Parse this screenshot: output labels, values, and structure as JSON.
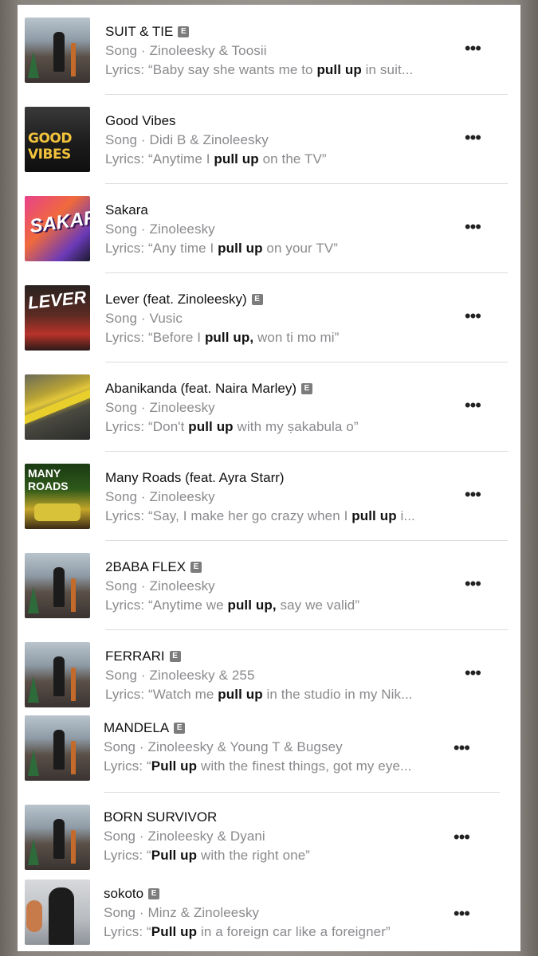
{
  "results": [
    {
      "title": "SUIT & TIE",
      "explicit": true,
      "subtitle": "Song · Zinoleesky & Toosii",
      "lyrics_prefix": "Lyrics: “Baby say she wants me to ",
      "lyrics_bold": "pull up",
      "lyrics_suffix": " in suit...",
      "art": "art-zino"
    },
    {
      "title": "Good Vibes",
      "explicit": false,
      "subtitle": "Song · Didi B & Zinoleesky",
      "lyrics_prefix": "Lyrics: “Anytime I ",
      "lyrics_bold": "pull up",
      "lyrics_suffix": " on the TV”",
      "art": "art-goodvibes",
      "art_text": "GOOD VIBES"
    },
    {
      "title": "Sakara",
      "explicit": false,
      "subtitle": "Song · Zinoleesky",
      "lyrics_prefix": "Lyrics: “Any time I ",
      "lyrics_bold": "pull up",
      "lyrics_suffix": " on your TV”",
      "art": "art-sakara",
      "art_text": "SAKARA"
    },
    {
      "title": "Lever (feat. Zinoleesky)",
      "explicit": true,
      "subtitle": "Song · Vusic",
      "lyrics_prefix": "Lyrics: “Before I ",
      "lyrics_bold": "pull up,",
      "lyrics_suffix": " won ti mo mi”",
      "art": "art-lever",
      "art_text": "LEVER"
    },
    {
      "title": "Abanikanda (feat. Naira Marley)",
      "explicit": true,
      "subtitle": "Song · Zinoleesky",
      "lyrics_prefix": "Lyrics: “Don't ",
      "lyrics_bold": "pull up",
      "lyrics_suffix": " with my ṣakabula o”",
      "art": "art-abani"
    },
    {
      "title": "Many Roads (feat. Ayra Starr)",
      "explicit": false,
      "subtitle": "Song · Zinoleesky",
      "lyrics_prefix": "Lyrics: “Say, I make her go crazy when I ",
      "lyrics_bold": "pull up",
      "lyrics_suffix": " i...",
      "art": "art-roads",
      "art_text": "MANY ROADS"
    },
    {
      "title": "2BABA FLEX",
      "explicit": true,
      "subtitle": "Song · Zinoleesky",
      "lyrics_prefix": "Lyrics: “Anytime we ",
      "lyrics_bold": "pull up,",
      "lyrics_suffix": " say we valid”",
      "art": "art-zino"
    },
    {
      "title": "FERRARI",
      "explicit": true,
      "subtitle": "Song · Zinoleesky & 255",
      "lyrics_prefix": "Lyrics: “Watch me ",
      "lyrics_bold": "pull up",
      "lyrics_suffix": " in the studio in my Nik...",
      "art": "art-zino"
    },
    {
      "title": "MANDELA",
      "explicit": true,
      "subtitle": "Song · Zinoleesky & Young T & Bugsey",
      "lyrics_prefix": "Lyrics: “",
      "lyrics_bold": "Pull up",
      "lyrics_suffix": " with the finest things, got my eye...",
      "art": "art-zino"
    },
    {
      "title": "BORN SURVIVOR",
      "explicit": false,
      "subtitle": "Song · Zinoleesky & Dyani",
      "lyrics_prefix": "Lyrics: “",
      "lyrics_bold": "Pull up",
      "lyrics_suffix": " with the right one”",
      "art": "art-zino"
    },
    {
      "title": "sokoto",
      "explicit": true,
      "subtitle": "Song · Minz & Zinoleesky",
      "lyrics_prefix": "Lyrics: “",
      "lyrics_bold": "Pull up",
      "lyrics_suffix": " in a foreign car like a foreigner”",
      "art": "art-minz"
    }
  ],
  "explicit_badge_label": "E",
  "more_label": "•••"
}
